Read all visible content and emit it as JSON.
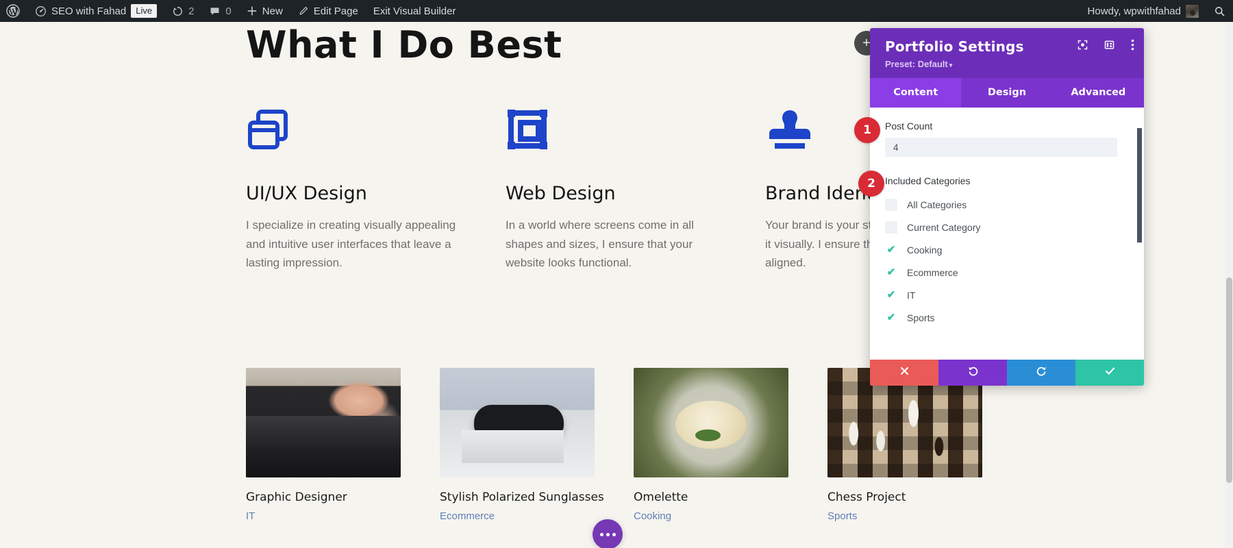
{
  "adminbar": {
    "wp_logo_icon": "wordpress-logo-icon",
    "site_icon": "dashboard-speedometer-icon",
    "site_name": "SEO with Fahad",
    "live_badge": "Live",
    "updates_icon": "updates-refresh-icon",
    "updates_count": "2",
    "comments_icon": "comment-bubble-icon",
    "comments_count": "0",
    "new_icon": "plus-icon",
    "new_label": "New",
    "edit_icon": "pencil-icon",
    "edit_label": "Edit Page",
    "exit_label": "Exit Visual Builder",
    "howdy": "Howdy, wpwithfahad",
    "avatar_icon": "user-avatar",
    "search_icon": "search-icon"
  },
  "page": {
    "title": "What I Do Best",
    "accent_blue": "#1d44c9",
    "background": "#f6f4ee",
    "services": [
      {
        "icon": "overlapping-windows-icon",
        "title": "UI/UX Design",
        "text": "I specialize in creating visually appealing and intuitive user interfaces that leave a lasting impression."
      },
      {
        "icon": "crop-frame-icon",
        "title": "Web Design",
        "text": "In a world where screens come in all shapes and sizes, I ensure that your website looks functional."
      },
      {
        "icon": "stamp-icon",
        "title": "Brand Identity",
        "text": "Your brand is your story, and I help you tell it visually. I ensure that all elements are aligned."
      }
    ],
    "portfolio": [
      {
        "thumb": "laptop-hands-photo",
        "title": "Graphic Designer",
        "category": "IT"
      },
      {
        "thumb": "sunglasses-photo",
        "title": "Stylish Polarized Sunglasses",
        "category": "Ecommerce"
      },
      {
        "thumb": "omelette-plate-photo",
        "title": "Omelette",
        "category": "Cooking"
      },
      {
        "thumb": "chessboard-photo",
        "title": "Chess Project",
        "category": "Sports"
      }
    ],
    "fab_icon": "ellipsis-icon",
    "add_module_icon": "plus-icon"
  },
  "modal": {
    "title": "Portfolio Settings",
    "preset_label": "Preset: Default",
    "preset_caret": "▾",
    "header_icons": [
      {
        "name": "focus-target-icon"
      },
      {
        "name": "layout-columns-icon"
      },
      {
        "name": "more-vertical-icon"
      }
    ],
    "tabs": [
      {
        "label": "Content",
        "active": true
      },
      {
        "label": "Design",
        "active": false
      },
      {
        "label": "Advanced",
        "active": false
      }
    ],
    "post_count": {
      "label": "Post Count",
      "value": "4"
    },
    "included_categories": {
      "label": "Included Categories",
      "items": [
        {
          "label": "All Categories",
          "checked": false
        },
        {
          "label": "Current Category",
          "checked": false
        },
        {
          "label": "Cooking",
          "checked": true
        },
        {
          "label": "Ecommerce",
          "checked": true
        },
        {
          "label": "IT",
          "checked": true
        },
        {
          "label": "Sports",
          "checked": true
        }
      ],
      "check_color": "#2ec4a6"
    },
    "footer_buttons": [
      {
        "name": "cancel-button",
        "icon": "close-x-icon",
        "color": "#ea5a57"
      },
      {
        "name": "undo-button",
        "icon": "undo-arrow-icon",
        "color": "#7b33cd"
      },
      {
        "name": "redo-button",
        "icon": "redo-arrow-icon",
        "color": "#2a8ed6"
      },
      {
        "name": "save-button",
        "icon": "checkmark-icon",
        "color": "#2ec4a6"
      }
    ],
    "header_color": "#6c2eb9"
  },
  "annotations": [
    {
      "number": "1",
      "target": "post-count-field"
    },
    {
      "number": "2",
      "target": "included-categories-field"
    }
  ]
}
